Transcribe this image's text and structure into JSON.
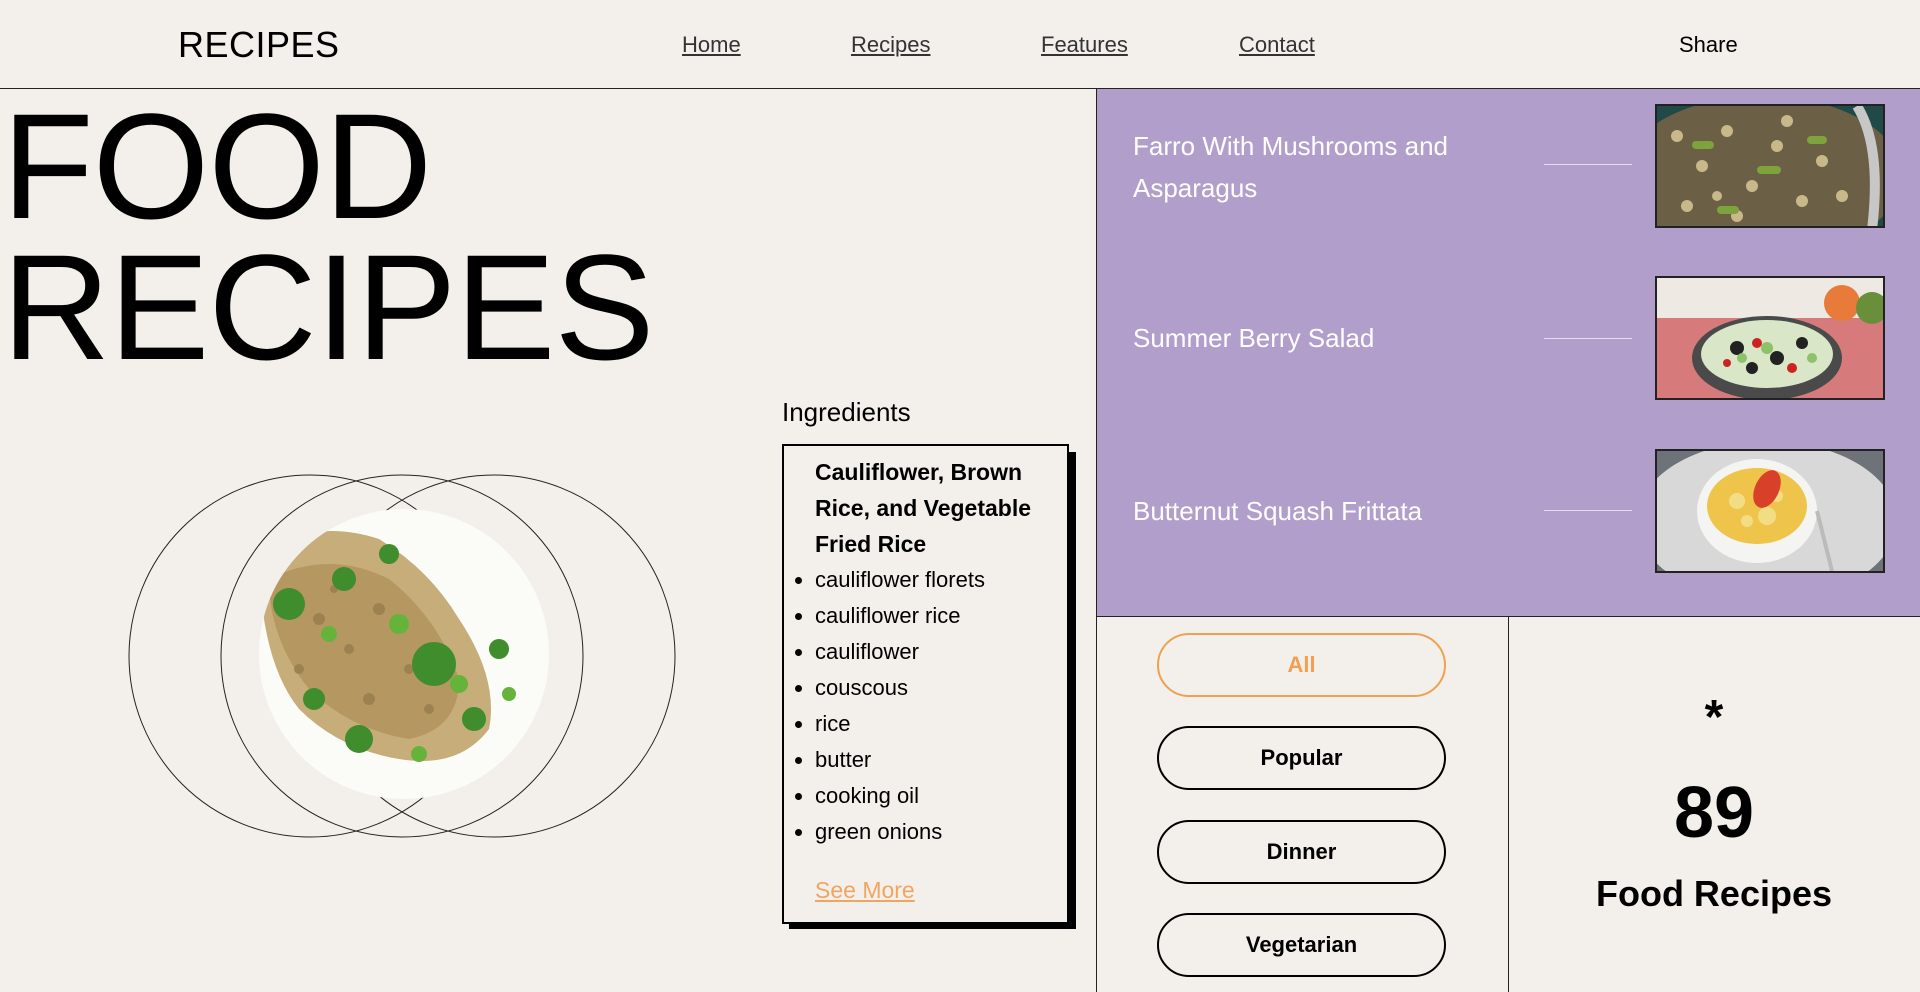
{
  "header": {
    "logo": "RECIPES",
    "nav": [
      "Home",
      "Recipes",
      "Features",
      "Contact"
    ],
    "share": "Share"
  },
  "hero": {
    "line1": "FOOD",
    "line2": "RECIPES"
  },
  "ingredients": {
    "title": "Ingredients",
    "recipe_name": "Cauliflower, Brown Rice, and Vegetable Fried Rice",
    "items": [
      "cauliflower florets",
      "cauliflower rice",
      "cauliflower",
      "couscous",
      "rice",
      "butter",
      "cooking oil",
      "green onions"
    ],
    "see_more": "See More"
  },
  "featured": [
    {
      "title": "Farro With Mushrooms and Asparagus"
    },
    {
      "title": "Summer Berry Salad"
    },
    {
      "title": "Butternut Squash Frittata"
    }
  ],
  "filters": [
    "All",
    "Popular",
    "Dinner",
    "Vegetarian"
  ],
  "active_filter": "All",
  "stats": {
    "symbol": "*",
    "count": "89",
    "label": "Food Recipes"
  },
  "colors": {
    "background": "#f3f0eb",
    "panel_purple": "#b19ecb",
    "accent_orange": "#f0a050"
  }
}
